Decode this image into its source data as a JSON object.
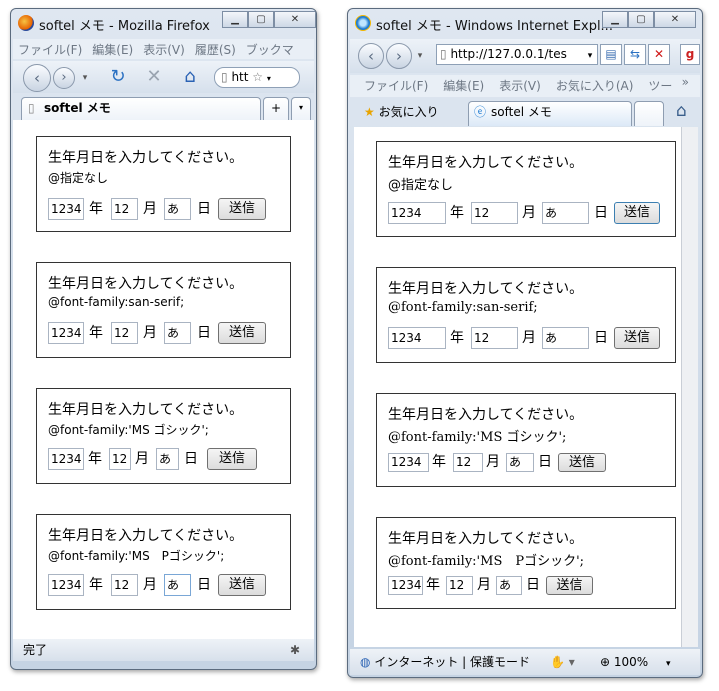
{
  "firefox": {
    "title": "softel メモ - Mozilla Firefox",
    "menus": [
      "ファイル(F)",
      "編集(E)",
      "表示(V)",
      "履歴(S)",
      "ブックマ"
    ],
    "url": "htt",
    "tab_label": "softel メモ",
    "tab_new": "+",
    "status": "完了"
  },
  "ie": {
    "title": "softel メモ - Windows Internet Expl...",
    "url": "http://127.0.0.1/tes",
    "menus": [
      "ファイル(F)",
      "編集(E)",
      "表示(V)",
      "お気に入り(A)",
      "ツー"
    ],
    "more": "»",
    "favorites": "お気に入り",
    "tab_label": "softel メモ",
    "status_zone": "インターネット | 保護モード",
    "zoom": "100%"
  },
  "cards": [
    {
      "heading": "生年月日を入力してください。",
      "note": "@指定なし",
      "year": "1234",
      "year_label": "年",
      "month": "12",
      "month_label": "月",
      "day": "あ",
      "day_label": "日",
      "button": "送信"
    },
    {
      "heading": "生年月日を入力してください。",
      "note": "@font-family:san-serif;",
      "year": "1234",
      "year_label": "年",
      "month": "12",
      "month_label": "月",
      "day": "あ",
      "day_label": "日",
      "button": "送信"
    },
    {
      "heading": "生年月日を入力してください。",
      "note": "@font-family:'MS ゴシック';",
      "year": "1234",
      "year_label": "年",
      "month": "12",
      "month_label": "月",
      "day": "あ",
      "day_label": "日",
      "button": "送信"
    },
    {
      "heading": "生年月日を入力してください。",
      "note": "@font-family:'MS　Pゴシック';",
      "year": "1234",
      "year_label": "年",
      "month": "12",
      "month_label": "月",
      "day": "あ",
      "day_label": "日",
      "button": "送信"
    }
  ]
}
